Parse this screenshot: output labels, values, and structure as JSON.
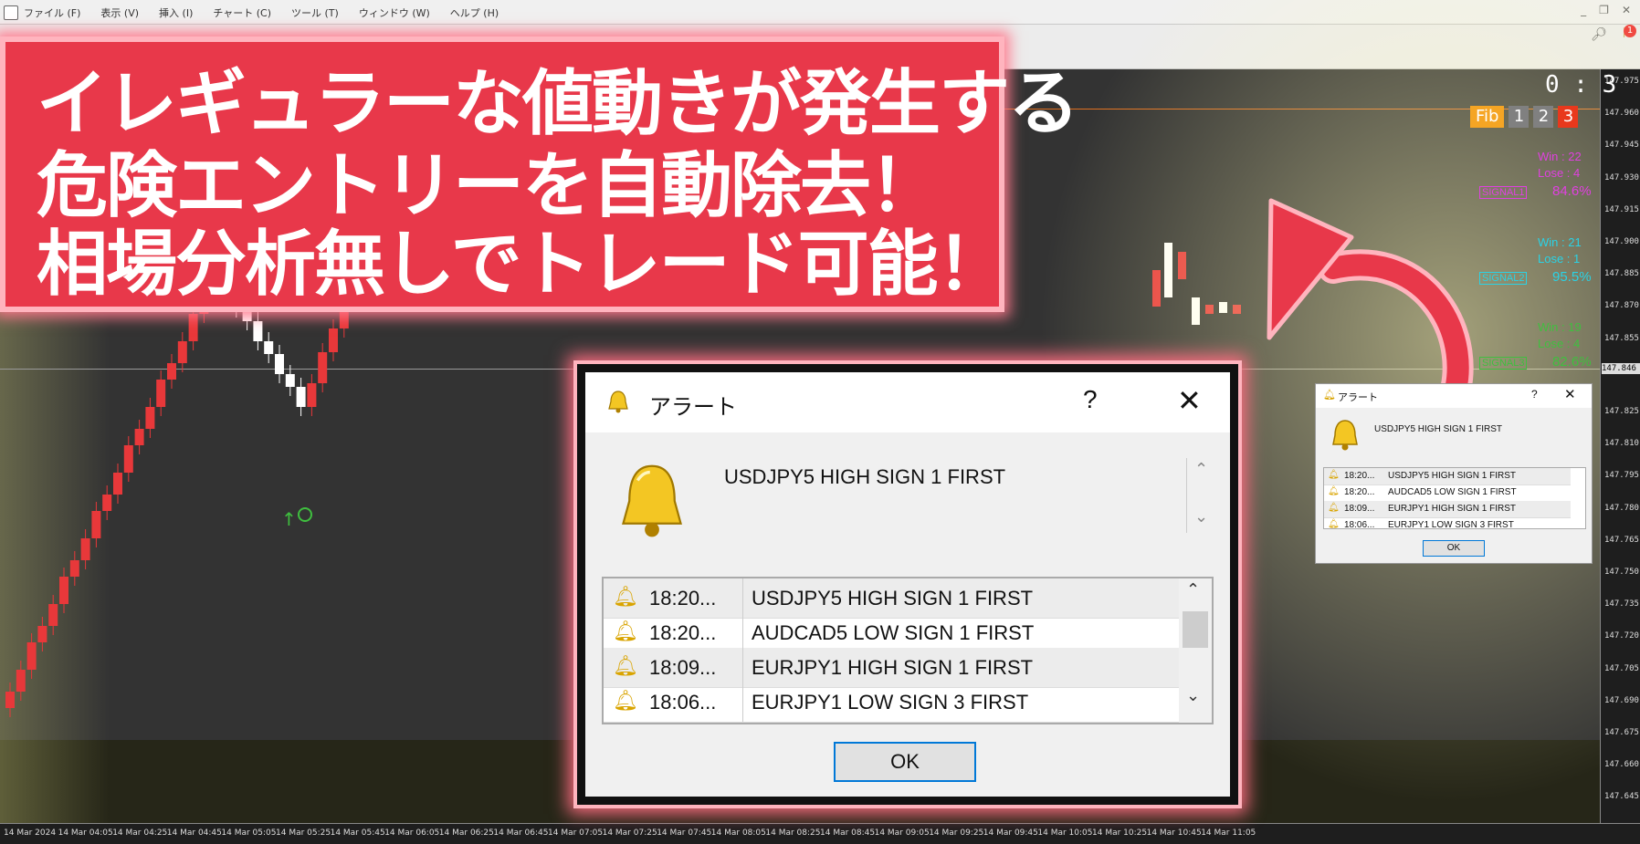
{
  "menu": [
    "ファイル (F)",
    "表示 (V)",
    "挿入 (I)",
    "チャート (C)",
    "ツール (T)",
    "ウィンドウ (W)",
    "ヘルプ (H)"
  ],
  "window_controls": [
    "_",
    "❐",
    "✕"
  ],
  "toolbar": {
    "notification_count": "1"
  },
  "banner": {
    "line1": "イレギュラーな値動きが発生する",
    "line2": "危険エントリーを自動除去！",
    "line3": "相場分析無しでトレード可能！",
    "color": "#e8384a"
  },
  "timer": "0 : 3",
  "fib": {
    "label": "Fib",
    "buttons": [
      "1",
      "2",
      "3"
    ],
    "active": "3"
  },
  "signals": [
    {
      "win": "Win  : 22",
      "lose": "Lose : 4",
      "pct": "84.6%",
      "tag": "SIGNAL1",
      "color": "#e040e0"
    },
    {
      "win": "Win  : 21",
      "lose": "Lose : 1",
      "pct": "95.5%",
      "tag": "SIGNAL2",
      "color": "#29d3e6"
    },
    {
      "win": "Win  : 19",
      "lose": "Lose : 4",
      "pct": "82.6%",
      "tag": "SIGNAL3",
      "color": "#3fbf3f"
    }
  ],
  "price_axis": [
    "147.975",
    "147.960",
    "147.945",
    "147.930",
    "147.915",
    "147.900",
    "147.885",
    "147.870",
    "147.855",
    "147.846",
    "147.825",
    "147.810",
    "147.795",
    "147.780",
    "147.765",
    "147.750",
    "147.735",
    "147.720",
    "147.705",
    "147.690",
    "147.675",
    "147.660",
    "147.645"
  ],
  "current_price": "147.846",
  "time_axis": [
    "14 Mar 2024",
    "14 Mar 04:05",
    "14 Mar 04:25",
    "14 Mar 04:45",
    "14 Mar 05:05",
    "14 Mar 05:25",
    "14 Mar 05:45",
    "14 Mar 06:05",
    "14 Mar 06:25",
    "14 Mar 06:45",
    "14 Mar 07:05",
    "14 Mar 07:25",
    "14 Mar 07:45",
    "14 Mar 08:05",
    "14 Mar 08:25",
    "14 Mar 08:45",
    "14 Mar 09:05",
    "14 Mar 09:25",
    "14 Mar 09:45",
    "14 Mar 10:05",
    "14 Mar 10:25",
    "14 Mar 10:45",
    "14 Mar 11:05"
  ],
  "alert": {
    "title": "アラート",
    "help": "?",
    "close": "✕",
    "message": "USDJPY5 HIGH SIGN 1 FIRST",
    "ok": "OK",
    "rows": [
      {
        "time": "18:20...",
        "text": "USDJPY5 HIGH SIGN 1 FIRST"
      },
      {
        "time": "18:20...",
        "text": "AUDCAD5 LOW SIGN 1 FIRST"
      },
      {
        "time": "18:09...",
        "text": "EURJPY1 HIGH SIGN 1 FIRST"
      },
      {
        "time": "18:06...",
        "text": "EURJPY1 LOW SIGN 3 FIRST"
      }
    ]
  },
  "colors": {
    "bull": "#ffffff",
    "bear": "#e8383a",
    "chart_bg": "#333333",
    "arrow": "#e8384a",
    "signal_up": "#3fbf3f"
  }
}
